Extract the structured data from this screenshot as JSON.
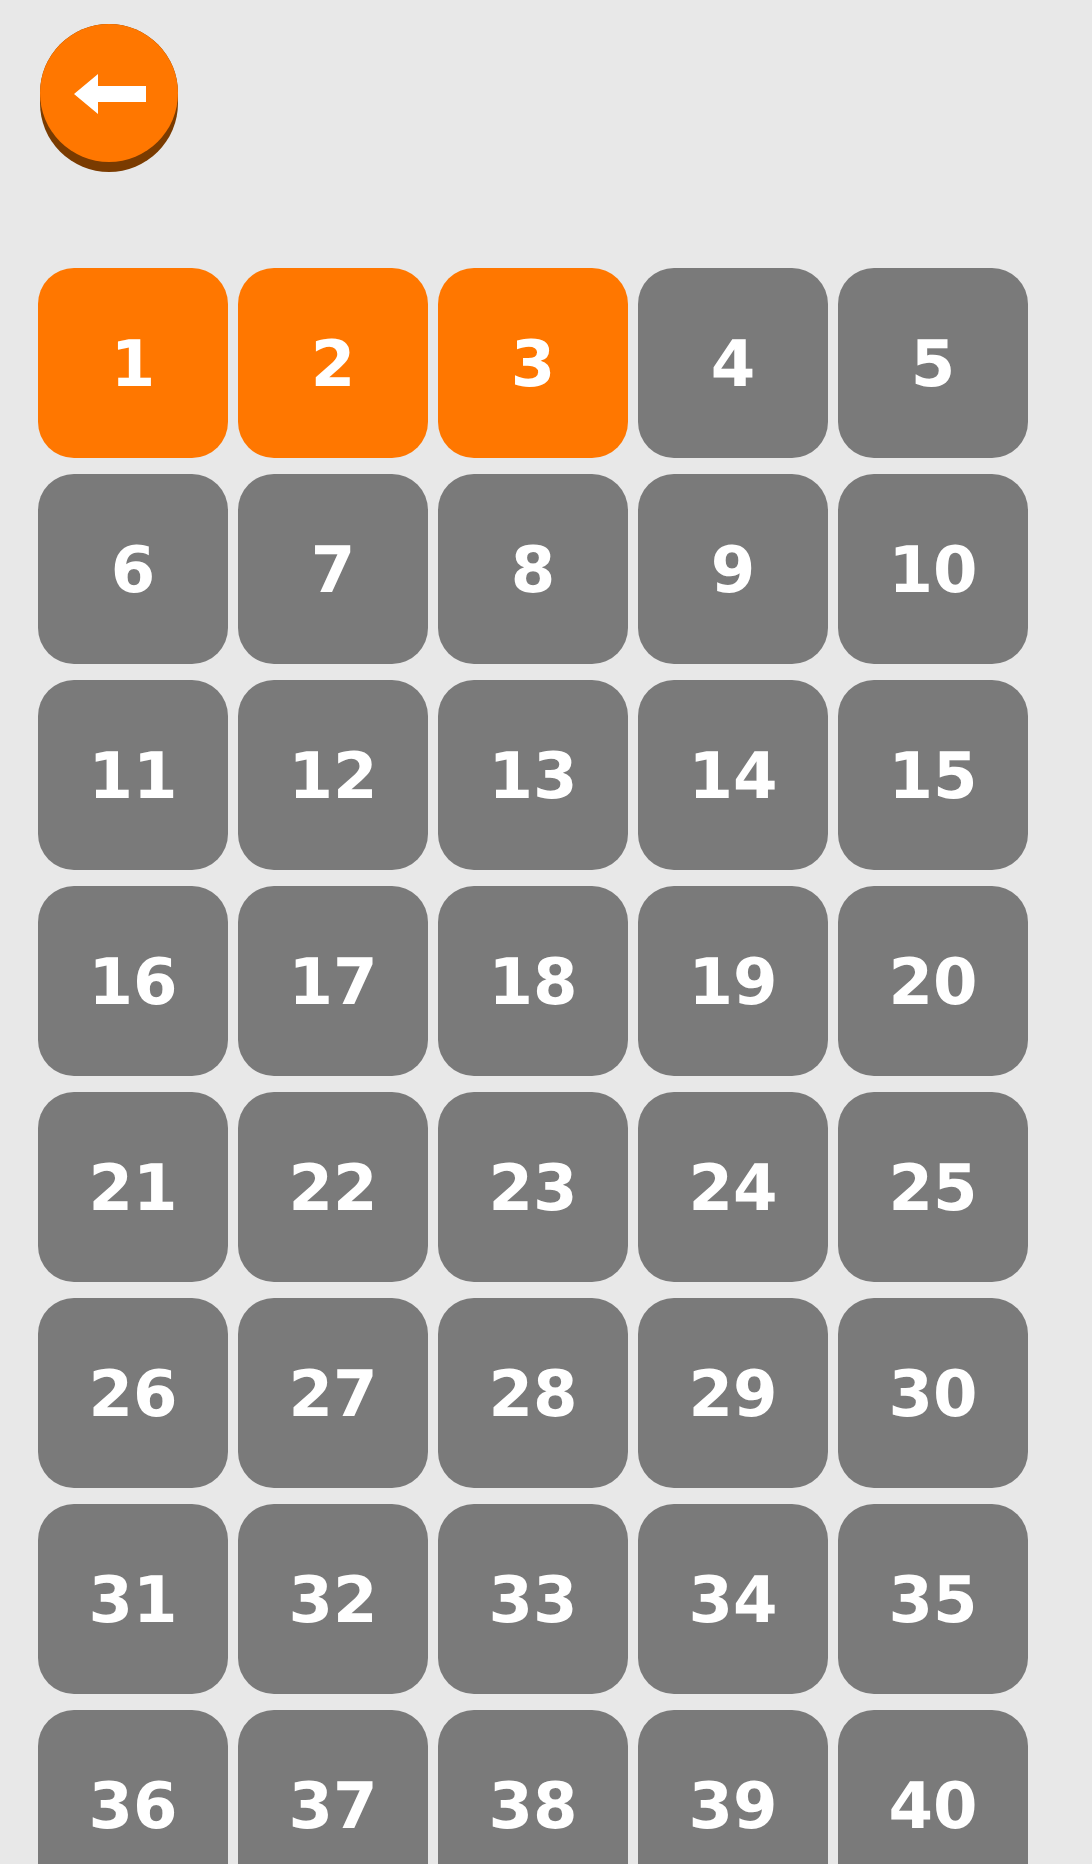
{
  "levels": [
    {
      "label": "1",
      "unlocked": true
    },
    {
      "label": "2",
      "unlocked": true
    },
    {
      "label": "3",
      "unlocked": true
    },
    {
      "label": "4",
      "unlocked": false
    },
    {
      "label": "5",
      "unlocked": false
    },
    {
      "label": "6",
      "unlocked": false
    },
    {
      "label": "7",
      "unlocked": false
    },
    {
      "label": "8",
      "unlocked": false
    },
    {
      "label": "9",
      "unlocked": false
    },
    {
      "label": "10",
      "unlocked": false
    },
    {
      "label": "11",
      "unlocked": false
    },
    {
      "label": "12",
      "unlocked": false
    },
    {
      "label": "13",
      "unlocked": false
    },
    {
      "label": "14",
      "unlocked": false
    },
    {
      "label": "15",
      "unlocked": false
    },
    {
      "label": "16",
      "unlocked": false
    },
    {
      "label": "17",
      "unlocked": false
    },
    {
      "label": "18",
      "unlocked": false
    },
    {
      "label": "19",
      "unlocked": false
    },
    {
      "label": "20",
      "unlocked": false
    },
    {
      "label": "21",
      "unlocked": false
    },
    {
      "label": "22",
      "unlocked": false
    },
    {
      "label": "23",
      "unlocked": false
    },
    {
      "label": "24",
      "unlocked": false
    },
    {
      "label": "25",
      "unlocked": false
    },
    {
      "label": "26",
      "unlocked": false
    },
    {
      "label": "27",
      "unlocked": false
    },
    {
      "label": "28",
      "unlocked": false
    },
    {
      "label": "29",
      "unlocked": false
    },
    {
      "label": "30",
      "unlocked": false
    },
    {
      "label": "31",
      "unlocked": false
    },
    {
      "label": "32",
      "unlocked": false
    },
    {
      "label": "33",
      "unlocked": false
    },
    {
      "label": "34",
      "unlocked": false
    },
    {
      "label": "35",
      "unlocked": false
    },
    {
      "label": "36",
      "unlocked": false
    },
    {
      "label": "37",
      "unlocked": false
    },
    {
      "label": "38",
      "unlocked": false
    },
    {
      "label": "39",
      "unlocked": false
    },
    {
      "label": "40",
      "unlocked": false
    }
  ]
}
